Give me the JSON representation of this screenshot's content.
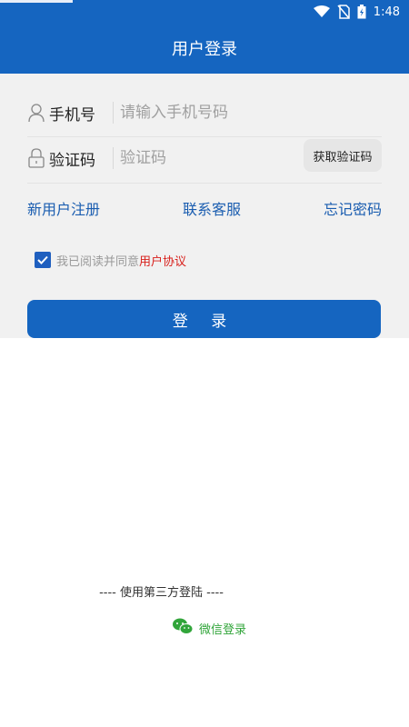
{
  "status_bar": {
    "time": "1:48"
  },
  "app_bar": {
    "title": "用户登录"
  },
  "form": {
    "phone_label": "手机号",
    "phone_placeholder": "请输入手机号码",
    "code_label": "验证码",
    "code_placeholder": "验证码",
    "get_code_label": "获取验证码"
  },
  "links": {
    "register": "新用户注册",
    "support": "联系客服",
    "forgot": "忘记密码"
  },
  "agreement": {
    "checked": true,
    "text": "我已阅读并同意",
    "link": "用户协议"
  },
  "login_button": {
    "label": "登 录"
  },
  "third_party": {
    "heading": "---- 使用第三方登陆 ----",
    "wechat_label": "微信登录"
  },
  "colors": {
    "primary": "#1565c0",
    "link": "#1a5db0",
    "agreement_link": "#d8201c",
    "wechat": "#31a53a"
  }
}
